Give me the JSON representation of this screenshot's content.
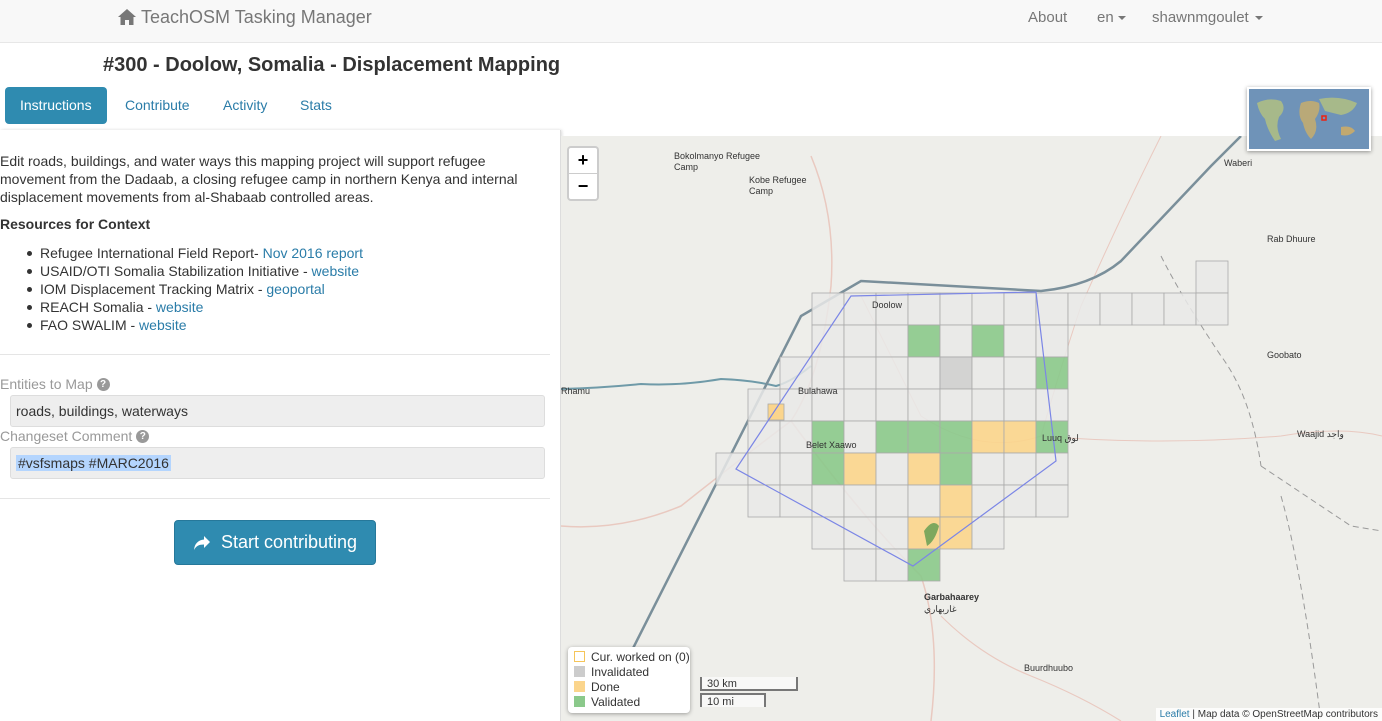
{
  "navbar": {
    "brand": "TeachOSM Tasking Manager",
    "about": "About",
    "language": "en",
    "user": "shawnmgoulet"
  },
  "project": {
    "title": "#300 - Doolow, Somalia - Displacement Mapping"
  },
  "tabs": [
    {
      "label": "Instructions"
    },
    {
      "label": "Contribute"
    },
    {
      "label": "Activity"
    },
    {
      "label": "Stats"
    }
  ],
  "instructions": {
    "description": "Edit roads, buildings, and water ways this mapping project will support refugee movement from the Dadaab, a closing refugee camp in northern Kenya and internal displacement movements from al-Shabaab controlled areas.",
    "resources_title": "Resources for Context",
    "resources": [
      {
        "text": "Refugee International Field Report- ",
        "link": "Nov 2016 report"
      },
      {
        "text": "USAID/OTI Somalia Stabilization Initiative - ",
        "link": "website"
      },
      {
        "text": "IOM Displacement Tracking Matrix - ",
        "link": "geoportal"
      },
      {
        "text": "REACH Somalia - ",
        "link": "website"
      },
      {
        "text": "FAO SWALIM - ",
        "link": "website"
      }
    ],
    "entities_label": "Entities to Map",
    "entities_value": "roads, buildings, waterways",
    "changeset_label": "Changeset Comment",
    "changeset_value": "#vsfsmaps #MARC2016",
    "start_button": "Start contributing"
  },
  "map": {
    "zoom_in": "+",
    "zoom_out": "−",
    "places": [
      {
        "name": "Bokolmanyo Refugee"
      },
      {
        "name": "Camp"
      },
      {
        "name": "Kobe Refugee"
      },
      {
        "name": "Camp"
      },
      {
        "name": "Waberi"
      },
      {
        "name": "Rab Dhuure"
      },
      {
        "name": "Doolow"
      },
      {
        "name": "Bulahawa"
      },
      {
        "name": "Rhamu"
      },
      {
        "name": "Belet Xaawo"
      },
      {
        "name": "Luuq لوق"
      },
      {
        "name": "Goobato"
      },
      {
        "name": "Waajid واجد"
      },
      {
        "name": "Garbahaarey"
      },
      {
        "name": "غاربهاري"
      },
      {
        "name": "Buurdhuubo"
      }
    ],
    "legend": [
      {
        "label": "Cur. worked on (0)",
        "color": "#ffffff",
        "border": "#f5c55a"
      },
      {
        "label": "Invalidated",
        "color": "#cccccc",
        "border": "#cccccc"
      },
      {
        "label": "Done",
        "color": "#fbd58c",
        "border": "#fbd58c"
      },
      {
        "label": "Validated",
        "color": "#8bc98b",
        "border": "#8bc98b"
      }
    ],
    "scale_km": "30 km",
    "scale_mi": "10 mi",
    "attribution_link": "Leaflet",
    "attribution_text": " | Map data © OpenStreetMap contributors"
  },
  "colors": {
    "primary": "#2f8bb0",
    "link": "#2a7ca8",
    "done": "#fbd58c",
    "validated": "#8bc98b",
    "invalidated": "#cccccc"
  }
}
